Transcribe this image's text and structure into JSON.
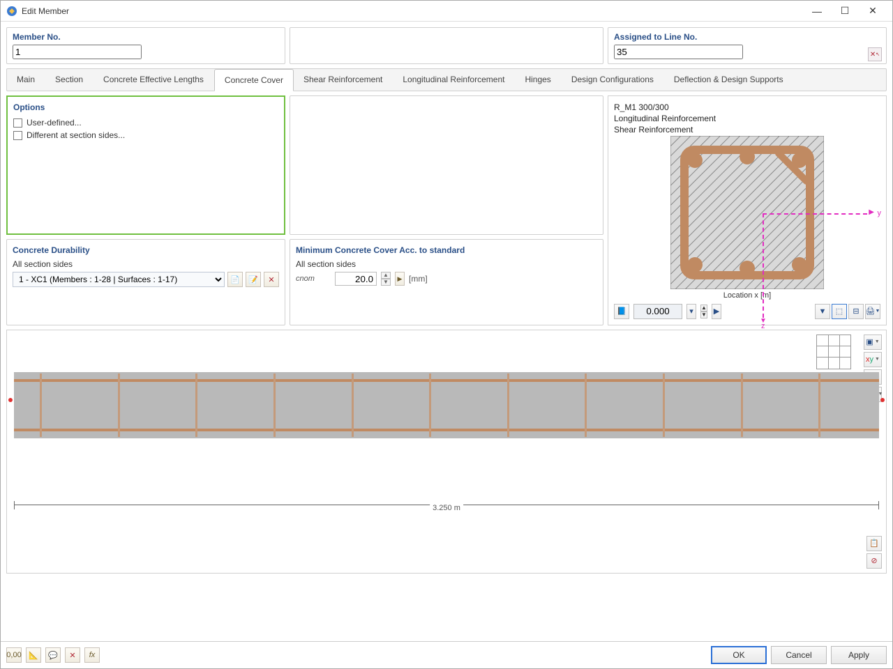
{
  "window": {
    "title": "Edit Member"
  },
  "header": {
    "member_label": "Member No.",
    "member_value": "1",
    "assigned_label": "Assigned to Line No.",
    "assigned_value": "35"
  },
  "tabs": [
    "Main",
    "Section",
    "Concrete Effective Lengths",
    "Concrete Cover",
    "Shear Reinforcement",
    "Longitudinal Reinforcement",
    "Hinges",
    "Design Configurations",
    "Deflection & Design Supports"
  ],
  "active_tab": "Concrete Cover",
  "options": {
    "title": "Options",
    "items": [
      "User-defined...",
      "Different at section sides..."
    ]
  },
  "durability": {
    "title": "Concrete Durability",
    "sublabel": "All section sides",
    "combo_value": "1 - XC1 (Members : 1-28 | Surfaces : 1-17)"
  },
  "mincover": {
    "title": "Minimum Concrete Cover Acc. to standard",
    "sublabel": "All section sides",
    "param": "cnom",
    "value": "20.0",
    "unit": "[mm]"
  },
  "section_info": {
    "line1": "R_M1 300/300",
    "line2": "Longitudinal Reinforcement",
    "line3": "Shear Reinforcement",
    "location_label": "Location x [m]",
    "location_value": "0.000",
    "y": "y",
    "z": "z"
  },
  "beam": {
    "length_label": "3.250 m"
  },
  "footer": {
    "ok": "OK",
    "cancel": "Cancel",
    "apply": "Apply"
  }
}
